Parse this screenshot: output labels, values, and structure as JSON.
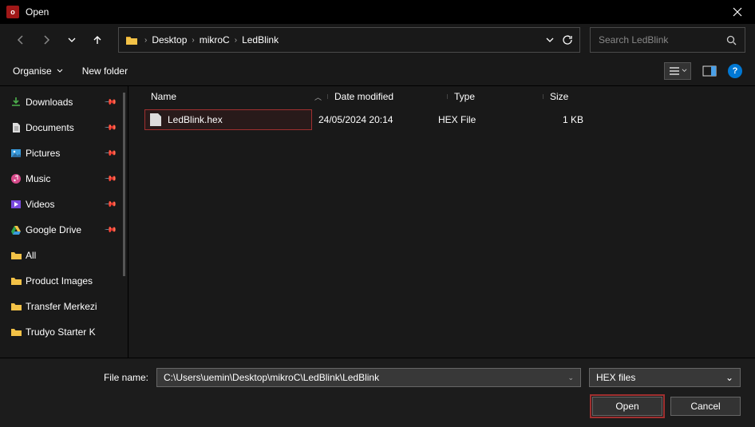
{
  "window": {
    "title": "Open"
  },
  "breadcrumb": {
    "a": "Desktop",
    "b": "mikroC",
    "c": "LedBlink"
  },
  "search": {
    "placeholder": "Search LedBlink"
  },
  "toolbar": {
    "organise": "Organise",
    "newfolder": "New folder"
  },
  "sidebar": {
    "items": [
      {
        "label": "Downloads",
        "icon": "download",
        "pin": true
      },
      {
        "label": "Documents",
        "icon": "doc",
        "pin": true
      },
      {
        "label": "Pictures",
        "icon": "pic",
        "pin": true
      },
      {
        "label": "Music",
        "icon": "music",
        "pin": true
      },
      {
        "label": "Videos",
        "icon": "video",
        "pin": true
      },
      {
        "label": "Google Drive",
        "icon": "gdrive",
        "pin": true
      },
      {
        "label": "All",
        "icon": "folder",
        "pin": false
      },
      {
        "label": "Product Images",
        "icon": "folder",
        "pin": false
      },
      {
        "label": "Transfer Merkezi",
        "icon": "folder",
        "pin": false
      },
      {
        "label": "Trudyo Starter K",
        "icon": "folder",
        "pin": false
      }
    ]
  },
  "columns": {
    "name": "Name",
    "date": "Date modified",
    "type": "Type",
    "size": "Size"
  },
  "files": [
    {
      "name": "LedBlink.hex",
      "date": "24/05/2024 20:14",
      "type": "HEX File",
      "size": "1 KB"
    }
  ],
  "filename": {
    "label": "File name:",
    "value": "C:\\Users\\uemin\\Desktop\\mikroC\\LedBlink\\LedBlink"
  },
  "filter": {
    "value": "HEX files"
  },
  "buttons": {
    "open": "Open",
    "cancel": "Cancel"
  }
}
